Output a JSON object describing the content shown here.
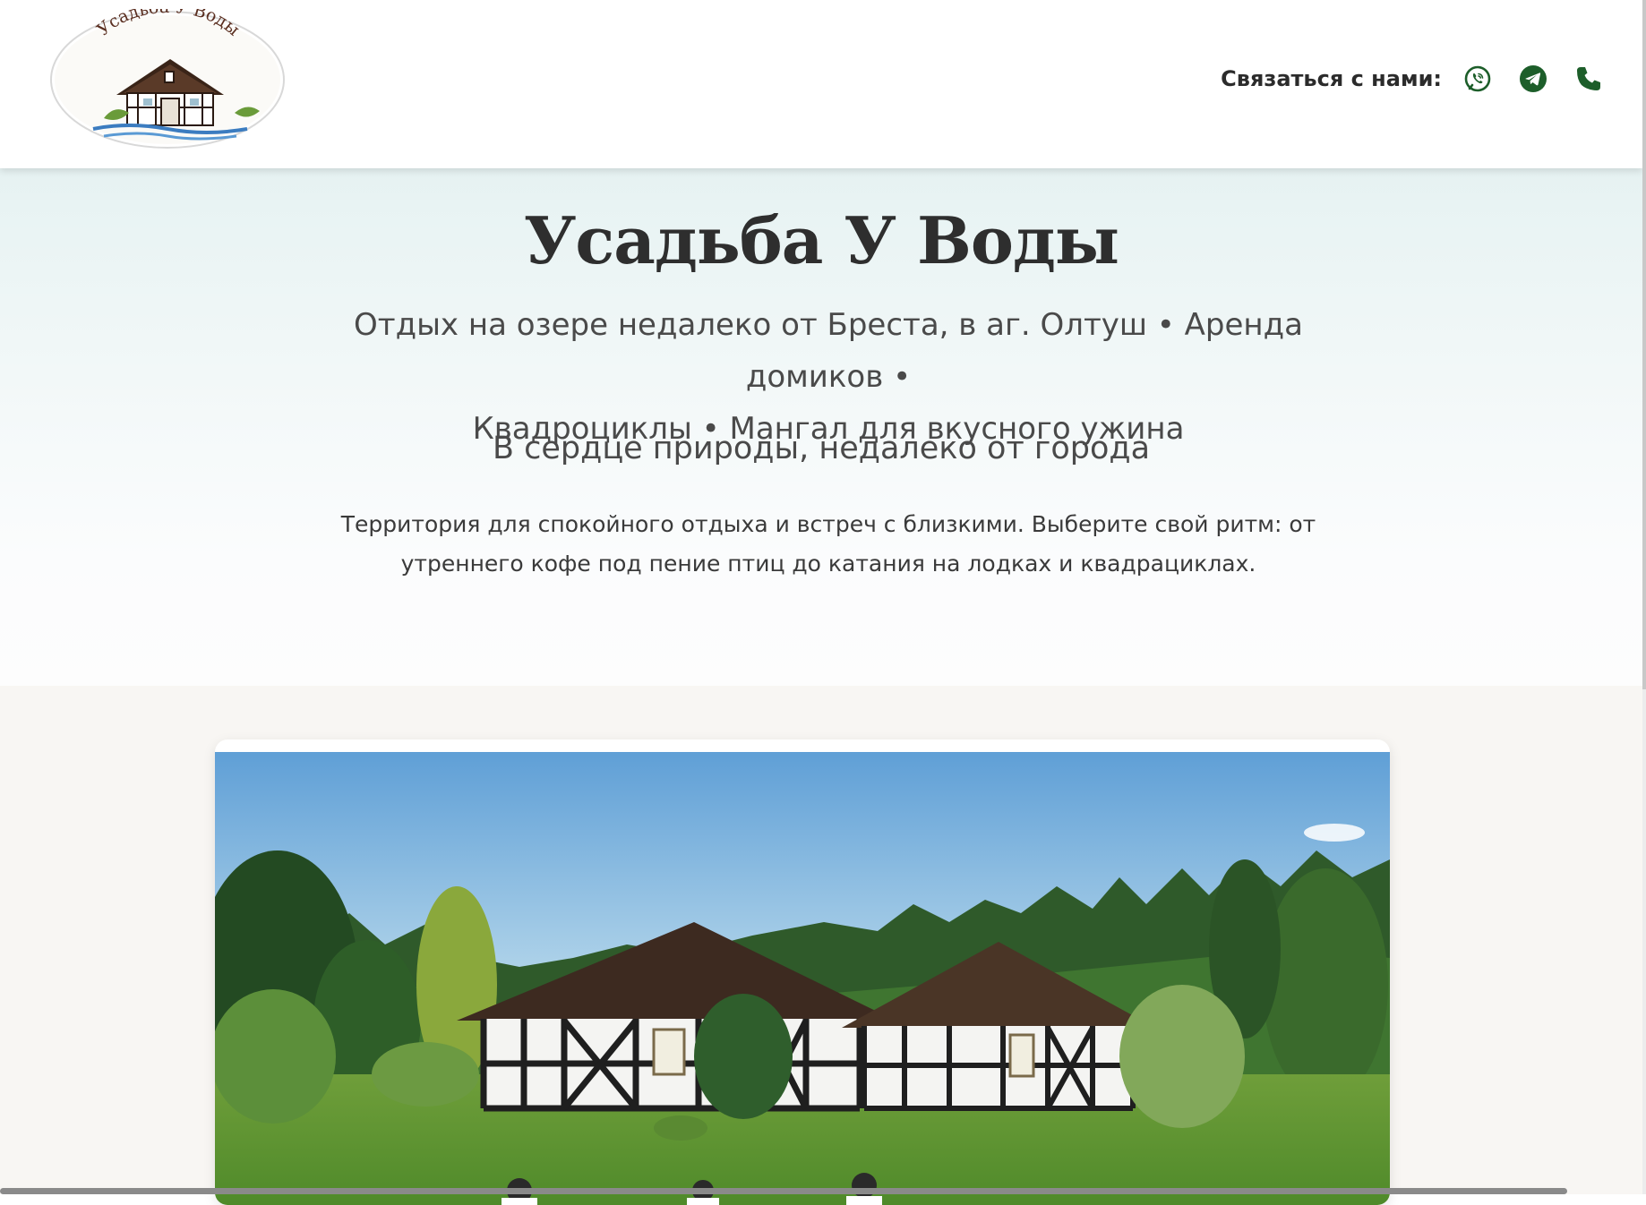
{
  "header": {
    "logo": {
      "alt": "Усадьба У Воды",
      "text": "Усадьба У Воды"
    },
    "contact_label": "Связаться с нами:",
    "contacts": [
      {
        "icon": "viber-icon",
        "color": "#1d5e2a"
      },
      {
        "icon": "telegram-icon",
        "color": "#1d5e2a"
      },
      {
        "icon": "phone-icon",
        "color": "#1d5e2a"
      }
    ]
  },
  "hero": {
    "title": "Усадьба У Воды",
    "subtitle_line1": "Отдых на озере недалеко от Бреста, в аг. Олтуш • Аренда домиков •",
    "subtitle_line2": "Квадроциклы • Мангал для вкусного ужина",
    "tagline": "В сердце природы, недалеко от города",
    "description_line1": "Территория для спокойного отдыха и встреч с близкими. Выберите свой ритм: от",
    "description_line2": "утреннего кофе под пение птиц до катания на лодках и квадрациклах."
  },
  "colors": {
    "accent": "#1d5e2a",
    "title": "#2e2e2e",
    "text": "#4a4a4a",
    "section_bg": "#f8f6f3"
  }
}
